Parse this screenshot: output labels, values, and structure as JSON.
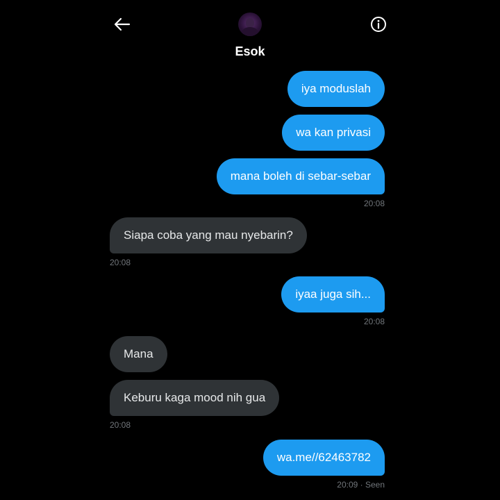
{
  "header": {
    "back_icon": "arrow-left-icon",
    "info_icon": "info-circle-icon",
    "contact_name": "Esok"
  },
  "messages": [
    {
      "direction": "out",
      "text": "iya moduslah"
    },
    {
      "direction": "out",
      "text": "wa kan privasi"
    },
    {
      "direction": "out",
      "text": "mana boleh di sebar-sebar",
      "time": "20:08"
    },
    {
      "direction": "in",
      "text": "Siapa coba yang mau nyebarin?",
      "time": "20:08"
    },
    {
      "direction": "out",
      "text": "iyaa juga sih...",
      "time": "20:08"
    },
    {
      "direction": "in",
      "text": "Mana"
    },
    {
      "direction": "in",
      "text": "Keburu kaga mood nih gua",
      "time": "20:08"
    },
    {
      "direction": "out",
      "text": "wa.me//62463782",
      "time": "20:09 · Seen"
    }
  ],
  "colors": {
    "background": "#000000",
    "outgoing_bubble": "#1d9bf0",
    "incoming_bubble": "#2f3336",
    "timestamp": "#71767b"
  }
}
